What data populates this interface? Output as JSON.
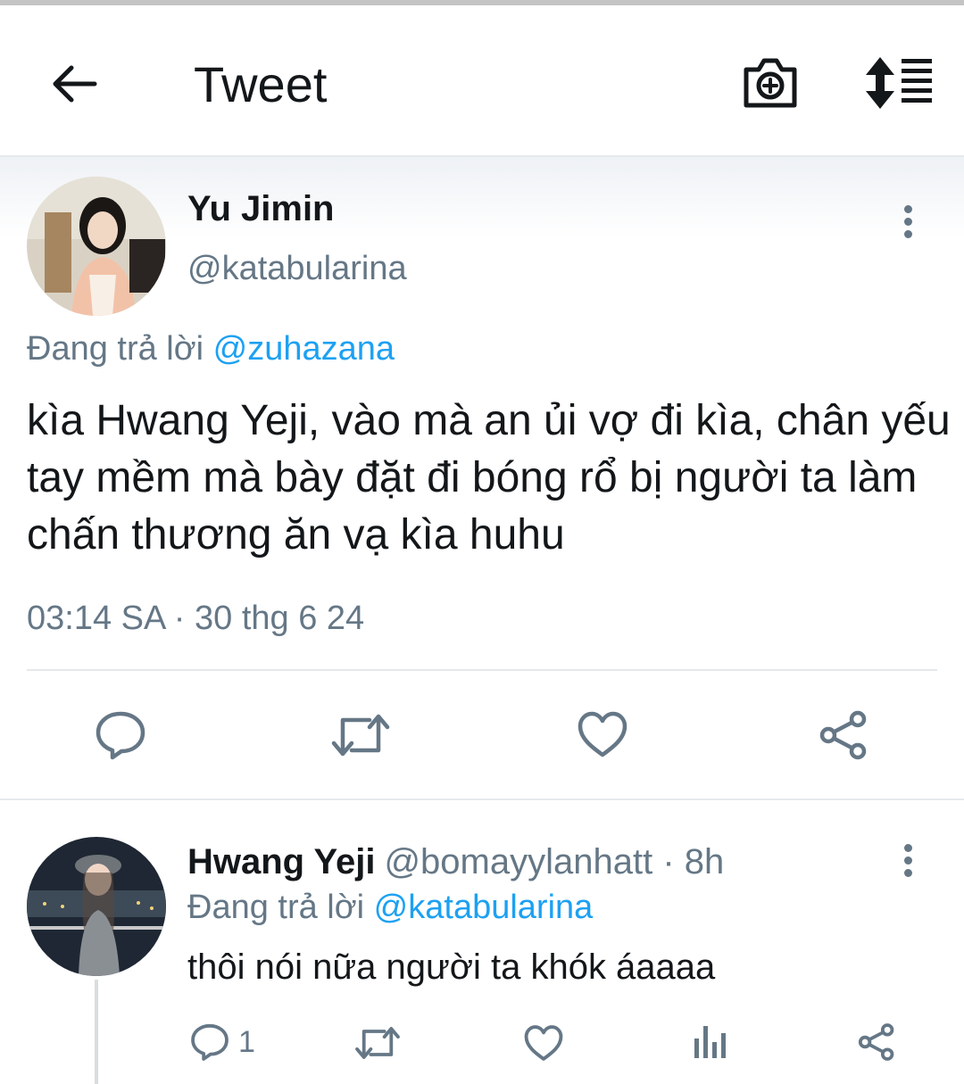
{
  "header": {
    "title": "Tweet",
    "back_icon": "arrow-left-icon",
    "camera_icon": "camera-add-icon",
    "sort_icon": "sort-list-icon"
  },
  "tweet": {
    "author_name": "Yu Jimin",
    "author_handle": "@katabularina",
    "replying_prefix": "Đang trả lời",
    "replying_to": "@zuhazana",
    "text": "kìa Hwang Yeji, vào mà an ủi vợ đi kìa, chân yếu tay mềm mà bày đặt đi bóng rổ bị người ta làm chấn thương ăn vạ kìa huhu",
    "timestamp": "03:14 SA · 30 thg 6 24",
    "actions": [
      "reply-icon",
      "retweet-icon",
      "like-icon",
      "share-icon"
    ]
  },
  "reply": {
    "author_name": "Hwang Yeji",
    "author_handle": "@bomayylanhatt · 8h",
    "replying_prefix": "Đang trả lời",
    "replying_to": "@katabularina",
    "text": "thôi nói nữa người ta khók áaaaa",
    "reply_count": "1",
    "actions": [
      "reply-icon",
      "retweet-icon",
      "like-icon",
      "analytics-icon",
      "share-icon"
    ]
  },
  "colors": {
    "text": "#14171a",
    "secondary": "#657786",
    "accent": "#1da1f2",
    "divider": "#e6e9eb"
  }
}
